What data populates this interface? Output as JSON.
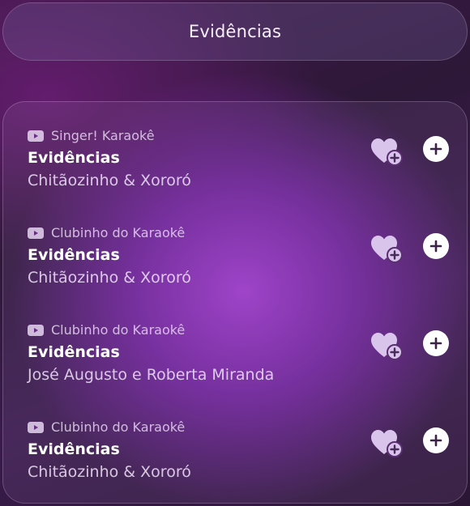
{
  "header": {
    "search_text": "Evidências"
  },
  "results": [
    {
      "channel": "Singer! Karaokê",
      "title": "Evidências",
      "artist": "Chitãozinho & Xororó"
    },
    {
      "channel": "Clubinho do Karaokê",
      "title": "Evidências",
      "artist": "Chitãozinho & Xororó"
    },
    {
      "channel": "Clubinho do Karaokê",
      "title": "Evidências",
      "artist": "José Augusto e Roberta Miranda"
    },
    {
      "channel": "Clubinho do Karaokê",
      "title": "Evidências",
      "artist": "Chitãozinho & Xororó"
    }
  ],
  "icons": {
    "source": "youtube-icon",
    "favorite": "heart-plus-icon",
    "add": "plus-circle-icon"
  },
  "colors": {
    "background_accent": "#a03ccd",
    "background_dark": "#2d1838",
    "heart": "#d9c4ec",
    "add_button": "#ffffff",
    "icon_glyph": "#4a2a5c"
  }
}
